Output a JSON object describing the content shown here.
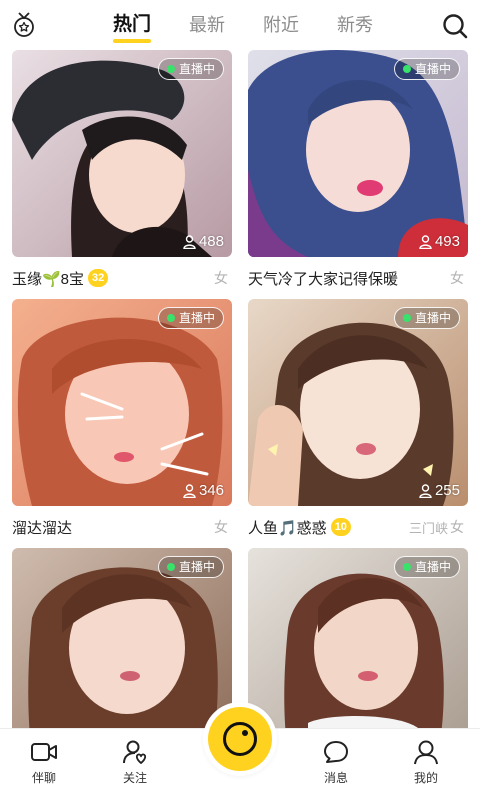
{
  "header": {
    "left_icon": "medal-icon",
    "tabs": [
      {
        "label": "热门",
        "active": true
      },
      {
        "label": "最新",
        "active": false
      },
      {
        "label": "附近",
        "active": false
      },
      {
        "label": "新秀",
        "active": false
      }
    ],
    "right_icon": "search-icon",
    "accent_color": "#ffd21f"
  },
  "live_badge": "直播中",
  "cards": [
    {
      "viewers": "488",
      "name": "玉缘🌱8宝",
      "level": "32",
      "city": "",
      "gender": "女"
    },
    {
      "viewers": "493",
      "name": "天气冷了大家记得保暖",
      "level": "",
      "city": "",
      "gender": "女"
    },
    {
      "viewers": "346",
      "name": "溜达溜达",
      "level": "",
      "city": "",
      "gender": "女"
    },
    {
      "viewers": "255",
      "name": "人鱼🎵惑惑",
      "level": "10",
      "city": "三门峡",
      "gender": "女"
    },
    {
      "viewers": "",
      "name": "",
      "level": "",
      "city": "",
      "gender": ""
    },
    {
      "viewers": "",
      "name": "",
      "level": "",
      "city": "",
      "gender": ""
    }
  ],
  "bottom_nav": {
    "items": [
      {
        "label": "伴聊",
        "icon": "video-camera-icon"
      },
      {
        "label": "关注",
        "icon": "follow-heart-icon"
      },
      {
        "label": "",
        "icon": "camera-lens-icon"
      },
      {
        "label": "消息",
        "icon": "chat-bubble-icon"
      },
      {
        "label": "我的",
        "icon": "profile-icon"
      }
    ]
  }
}
